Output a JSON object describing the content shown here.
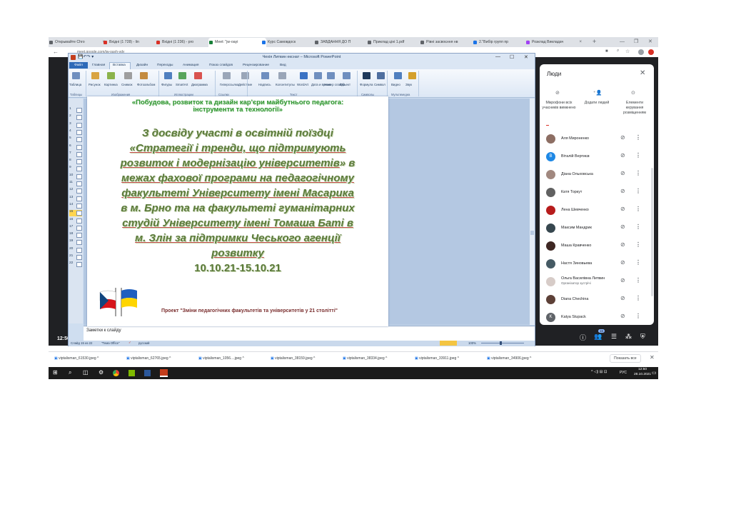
{
  "browser": {
    "tabs": [
      {
        "label": "Открывайте Chro",
        "color": "#5f6368"
      },
      {
        "label": "Вхідні (1 728) - lin",
        "color": "#d93025"
      },
      {
        "label": "Вхідні (1 236) - pro",
        "color": "#d93025"
      },
      {
        "label": "Meet: \"jw-oayi",
        "color": "#188038"
      },
      {
        "label": "Курс Самовдоск",
        "color": "#1a73e8"
      },
      {
        "label": "ЗАВДАННЯ ДО П",
        "color": "#5f6368"
      },
      {
        "label": "Приклад ціні 1.pdf",
        "color": "#5f6368"
      },
      {
        "label": "Рівні засвоєння нв",
        "color": "#5f6368"
      },
      {
        "label": "2.\"Вибір групп пр",
        "color": "#1a73e8"
      },
      {
        "label": "Розклад Викладач",
        "color": "#a142f4"
      }
    ],
    "new_tab": "+",
    "window_controls": [
      "—",
      "❐",
      "✕"
    ],
    "address": "meet.google.com/jw-oayh-vdy"
  },
  "ppt": {
    "title": "Чехія Литвин екснат – Microsoft PowerPoint",
    "file_tab": "Файл",
    "ribbon_tabs": [
      "Главная",
      "Вставка",
      "Дизайн",
      "Переходы",
      "Анимация",
      "Показ слайдов",
      "Рецензирование",
      "Вид"
    ],
    "buttons": [
      "Таблица",
      "Рисунок",
      "Картинка",
      "Снимок",
      "Фотоальбом",
      "Фигуры",
      "SmartArt",
      "Диаграмма",
      "Гиперссылка",
      "Действие",
      "Надпись",
      "Колонтитулы",
      "WordArt",
      "Дата и время",
      "Номер слайда",
      "Объект",
      "Формула",
      "Символ",
      "Видео",
      "Звук"
    ],
    "groups": [
      "Таблицы",
      "Изображения",
      "Иллюстрации",
      "Ссылки",
      "Текст",
      "Символы",
      "Мультимедиа"
    ],
    "slide_numbers": [
      "1",
      "2",
      "3",
      "4",
      "5",
      "6",
      "7",
      "8",
      "9",
      "10",
      "11",
      "12",
      "13",
      "14",
      "15",
      "16",
      "17",
      "18",
      "19",
      "20",
      "21",
      "22"
    ],
    "current_slide": "15",
    "notes_placeholder": "Заметки к слайду",
    "status_slide": "Слайд 15 из 22",
    "status_theme": "\"Тема Office\"",
    "status_lang": "русский",
    "zoom": "100%"
  },
  "slide": {
    "header_line1": "«Побудова, розвиток та дизайн кар'єри майбутнього педагога:",
    "header_line2": "інструменти та технології»",
    "body_l1": "З досвіду участі в освітній поїздці",
    "body_l2": "«Стратегії і тренди, що підтримують",
    "body_l3a": "розвиток і модернізацію університетів",
    "body_l3b": "» в",
    "body_l4": "межах фахової програми на педагогічному",
    "body_l5": "факультеті Університету імені Масарика",
    "body_l6": "в м. Брно та на факультеті гуманітарних",
    "body_l7": "студій Університету імені Томаша Баті в",
    "body_l8": "м. Злін за підтримки Чеського агенції",
    "body_l9": "розвитку",
    "dates": "10.10.21-15.10.21",
    "project": "Проект \"Зміни педагогічних факультетів та університетів у 21 столітті\""
  },
  "meet": {
    "time": "12:50",
    "people_count": "16"
  },
  "people": {
    "title": "Люди",
    "actions": [
      {
        "label": "Мікрофони всіх учасників вимкнено",
        "icon": "mic-off-icon"
      },
      {
        "label": "Додати людей",
        "icon": "add-person-icon"
      },
      {
        "label": "Елементи керування розміщенням",
        "icon": "toggle-icon"
      }
    ],
    "list": [
      {
        "name": "Аля Мироненко",
        "sub": "",
        "avatar_color": "#8d6e63",
        "initial": ""
      },
      {
        "name": "Віталій Вертиєв",
        "sub": "",
        "avatar_color": "#1e88e5",
        "initial": "В"
      },
      {
        "name": "Діана Ольховська",
        "sub": "",
        "avatar_color": "#a1887f",
        "initial": ""
      },
      {
        "name": "Катя Торкут",
        "sub": "",
        "avatar_color": "#616161",
        "initial": ""
      },
      {
        "name": "Лена Шевченко",
        "sub": "",
        "avatar_color": "#b71c1c",
        "initial": ""
      },
      {
        "name": "Максим Мандрик",
        "sub": "",
        "avatar_color": "#37474f",
        "initial": ""
      },
      {
        "name": "Маша Кравченко",
        "sub": "",
        "avatar_color": "#3e2723",
        "initial": ""
      },
      {
        "name": "Настя Зиновьева",
        "sub": "",
        "avatar_color": "#455a64",
        "initial": ""
      },
      {
        "name": "Ольга Василівна Литвин",
        "sub": "Організатор зустрічі",
        "avatar_color": "#d7ccc8",
        "initial": ""
      },
      {
        "name": "Diana Chechina",
        "sub": "",
        "avatar_color": "#5d4037",
        "initial": ""
      },
      {
        "name": "Katya Stupack",
        "sub": "",
        "avatar_color": "#5f6368",
        "initial": "K"
      }
    ]
  },
  "downloads": {
    "items": [
      "viptalisman_61530.jpeg",
      "viptalisman_62765.jpeg",
      "viptalisman_1056....jpeg",
      "viptalisman_38159.jpeg",
      "viptalisman_38334.jpeg",
      "viptalisman_33911.jpeg",
      "viptalisman_34906.jpeg"
    ],
    "show_all": "Показать все"
  },
  "taskbar": {
    "lang": "РУС",
    "time": "12:50",
    "date": "28.10.2021"
  }
}
